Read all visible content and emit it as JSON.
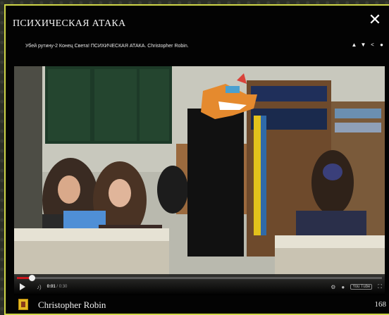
{
  "lightbox": {
    "title": "ПСИХИЧЕСКАЯ АТАКА",
    "subtitle": "Убей рутину-2 Конец Света! ПСИХИЧЕСКАЯ АТАКА. Christopher Robin.",
    "close_label": "✕",
    "actions": [
      "thumbs-up-icon",
      "thumbs-down-icon",
      "share-icon",
      "info-icon"
    ]
  },
  "player": {
    "current_time": "0:01",
    "duration": " / 0:30",
    "progress": 0.04,
    "logo_label": "You Tube"
  },
  "footer": {
    "channel": "Christopher Robin",
    "count": "168"
  },
  "colors": {
    "accent_border": "#cfd648",
    "progress": "#cc181e"
  }
}
